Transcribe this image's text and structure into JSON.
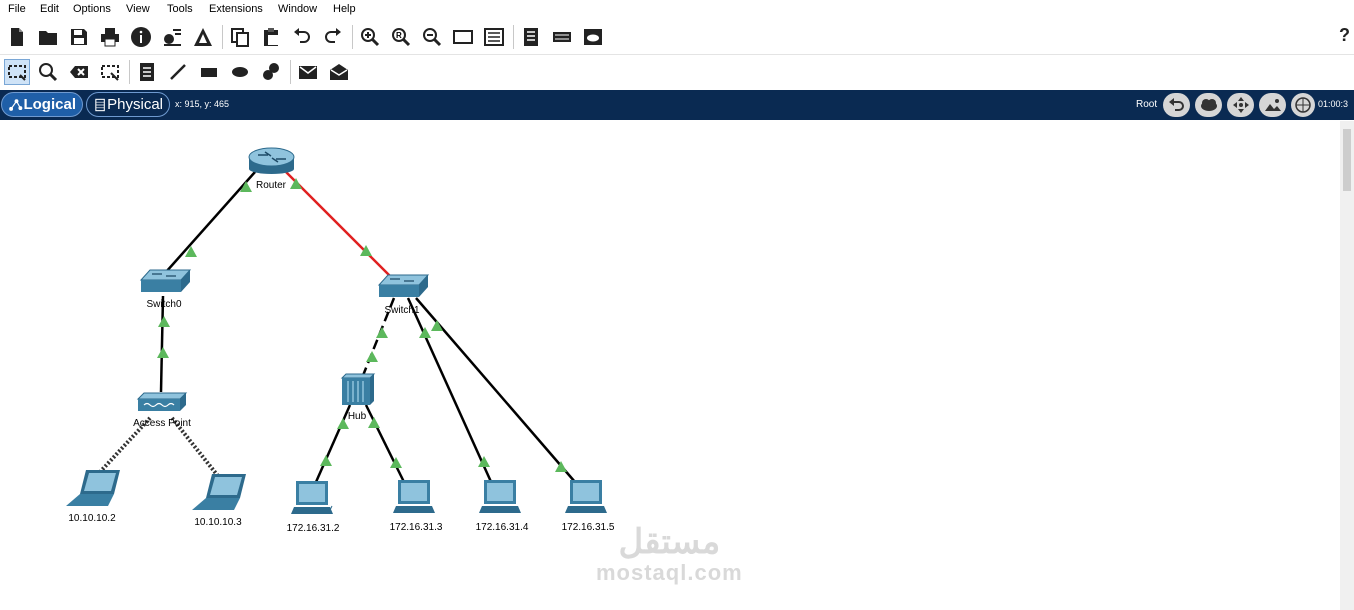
{
  "menu": [
    "File",
    "Edit",
    "Options",
    "View",
    "Tools",
    "Extensions",
    "Window",
    "Help"
  ],
  "toolbar_help": "?",
  "workspace": {
    "tab_logical": "Logical",
    "tab_physical": "Physical",
    "coords": "x: 915, y: 465",
    "root_label": "Root",
    "time": "01:00:3"
  },
  "devices": {
    "router": "Router",
    "switch0": "Switch0",
    "switch1": "Switch1",
    "access_point": "Access Point",
    "hub": "Hub",
    "laptop1": "10.10.10.2",
    "laptop2": "10.10.10.3",
    "pc1": "172.16.31.2",
    "pc2": "172.16.31.3",
    "pc3": "172.16.31.4",
    "pc4": "172.16.31.5"
  },
  "watermark": {
    "arabic": "مستقل",
    "latin": "mostaql.com"
  },
  "colors": {
    "navbar": "#0a2a52",
    "link_up": "#5cb85c",
    "link_serial": "#e02020",
    "device": "#3a7fa3"
  }
}
